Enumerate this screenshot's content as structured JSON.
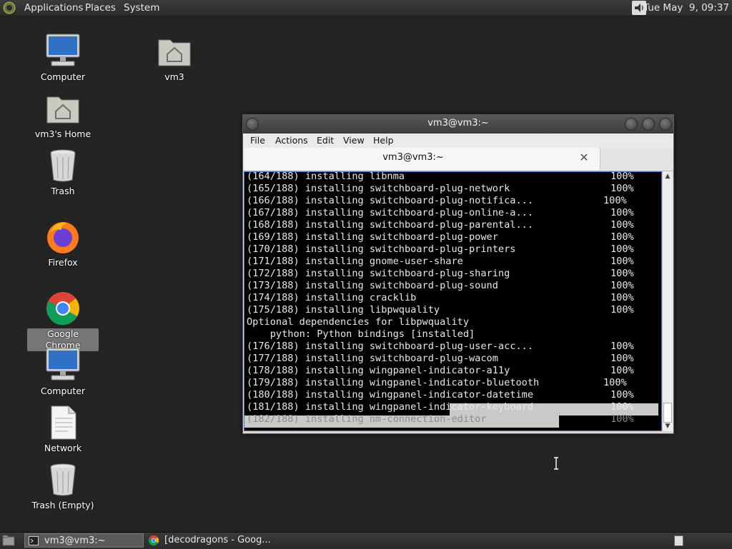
{
  "top_panel": {
    "menus": [
      "Applications",
      "Places",
      "System"
    ],
    "clock": "Tue May  9, 09:37",
    "logo_icon": "gnome-foot-icon",
    "volume_icon": "speaker-icon"
  },
  "desktop": {
    "icons": [
      {
        "label": "Computer",
        "icon": "computer-icon"
      },
      {
        "label": "vm3's Home",
        "icon": "home-folder-icon"
      },
      {
        "label": "Trash",
        "icon": "trash-icon"
      },
      {
        "label": "Firefox",
        "icon": "firefox-icon"
      },
      {
        "label": "Google Chrome",
        "icon": "chrome-icon",
        "selected": true
      },
      {
        "label": "Computer",
        "icon": "computer-icon"
      },
      {
        "label": "Network",
        "icon": "document-icon"
      },
      {
        "label": "Trash (Empty)",
        "icon": "trash-icon"
      },
      {
        "label": "vm3",
        "icon": "home-folder-icon"
      }
    ]
  },
  "terminal": {
    "window_title": "vm3@vm3:~",
    "menus": [
      "File",
      "Actions",
      "Edit",
      "View",
      "Help"
    ],
    "tab_title": "vm3@vm3:~",
    "lines": [
      {
        "text": "(164/188) installing libnma",
        "pct": "100%"
      },
      {
        "text": "(165/188) installing switchboard-plug-network",
        "pct": "100%"
      },
      {
        "text": "(166/188) installing switchboard-plug-notifica...",
        "pct": "100%"
      },
      {
        "text": "(167/188) installing switchboard-plug-online-a...",
        "pct": "100%"
      },
      {
        "text": "(168/188) installing switchboard-plug-parental...",
        "pct": "100%"
      },
      {
        "text": "(169/188) installing switchboard-plug-power",
        "pct": "100%"
      },
      {
        "text": "(170/188) installing switchboard-plug-printers",
        "pct": "100%"
      },
      {
        "text": "(171/188) installing gnome-user-share",
        "pct": "100%"
      },
      {
        "text": "(172/188) installing switchboard-plug-sharing",
        "pct": "100%"
      },
      {
        "text": "(173/188) installing switchboard-plug-sound",
        "pct": "100%"
      },
      {
        "text": "(174/188) installing cracklib",
        "pct": "100%"
      },
      {
        "text": "(175/188) installing libpwquality",
        "pct": "100%"
      },
      {
        "text": "Optional dependencies for libpwquality",
        "pct": ""
      },
      {
        "text": "    python: Python bindings [installed]",
        "pct": ""
      },
      {
        "text": "(176/188) installing switchboard-plug-user-acc...",
        "pct": "100%"
      },
      {
        "text": "(177/188) installing switchboard-plug-wacom",
        "pct": "100%"
      },
      {
        "text": "(178/188) installing wingpanel-indicator-a11y",
        "pct": "100%"
      },
      {
        "text": "(179/188) installing wingpanel-indicator-bluetooth",
        "pct": "100%"
      },
      {
        "text": "(180/188) installing wingpanel-indicator-datetime",
        "pct": "100%"
      },
      {
        "text": "(181/188) installing wingpanel-indicator-keyboard",
        "pct": "100%"
      },
      {
        "text": "(182/188) installing nm-connection-editor",
        "pct": "100%"
      }
    ]
  },
  "taskbar": {
    "show_desktop_icon": "show-desktop-icon",
    "tasks": [
      {
        "label": "vm3@vm3:~",
        "icon": "terminal-icon",
        "active": true
      },
      {
        "label": "[decodragons - Goog...",
        "icon": "chrome-icon",
        "active": false
      }
    ],
    "workspace_icon": "workspace-switcher-icon"
  }
}
